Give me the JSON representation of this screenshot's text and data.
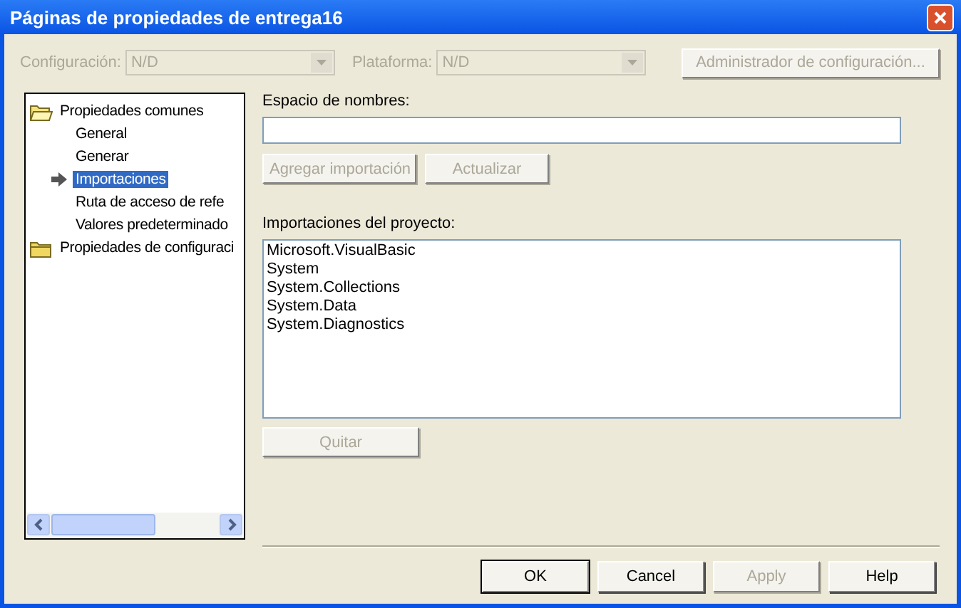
{
  "window": {
    "title": "Páginas de propiedades de entrega16"
  },
  "config_bar": {
    "configuration": {
      "label": "Configuración:",
      "value": "N/D",
      "disabled": true
    },
    "platform": {
      "label": "Plataforma:",
      "value": "N/D",
      "disabled": true
    },
    "manager_button": {
      "label": "Administrador de configuración...",
      "disabled": true
    }
  },
  "tree": [
    {
      "label": "Propiedades comunes",
      "expanded": true,
      "children": [
        {
          "label": "General",
          "selected": false
        },
        {
          "label": "Generar",
          "selected": false
        },
        {
          "label": "Importaciones",
          "selected": true
        },
        {
          "label": "Ruta de acceso de refe",
          "selected": false
        },
        {
          "label": "Valores predeterminado",
          "selected": false
        }
      ]
    },
    {
      "label": "Propiedades de configuraci",
      "expanded": false
    }
  ],
  "namespace": {
    "label": "Espacio de nombres:"
  },
  "namespace_buttons": [
    {
      "label": "Agregar importación",
      "disabled": true
    },
    {
      "label": "Actualizar",
      "disabled": true
    }
  ],
  "imports": {
    "label": "Importaciones del proyecto:",
    "items": [
      "Microsoft.VisualBasic",
      "System",
      "System.Collections",
      "System.Data",
      "System.Diagnostics"
    ]
  },
  "remove_button": {
    "label": "Quitar",
    "disabled": true
  },
  "dialog_buttons": [
    {
      "label": "OK",
      "disabled": false,
      "default": true
    },
    {
      "label": "Cancel",
      "disabled": false,
      "default": false
    },
    {
      "label": "Apply",
      "disabled": true,
      "default": false
    },
    {
      "label": "Help",
      "disabled": false,
      "default": false
    }
  ]
}
